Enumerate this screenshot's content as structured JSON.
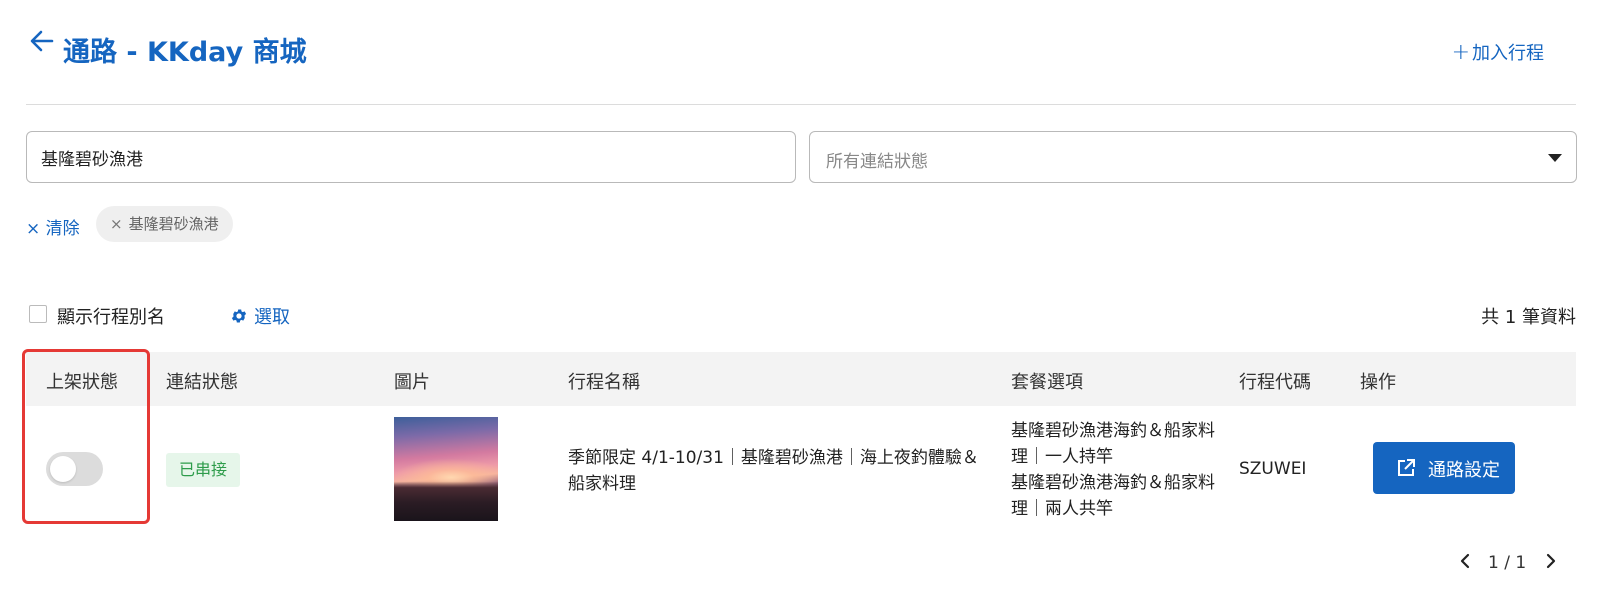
{
  "header": {
    "title": "通路  - KKday 商城",
    "add_label": "加入行程",
    "add_icon": "plus-icon",
    "back_icon": "arrow-left-icon"
  },
  "filters": {
    "search_value": "基隆碧砂漁港",
    "status_placeholder": "所有連結狀態",
    "clear_label": "清除",
    "chips": [
      "基隆碧砂漁港"
    ]
  },
  "toolbar": {
    "show_alias_label": "顯示行程別名",
    "show_alias_checked": false,
    "select_label": "選取",
    "total_text": "共 1 筆資料"
  },
  "table": {
    "columns": [
      "上架狀態",
      "連結狀態",
      "圖片",
      "行程名稱",
      "套餐選項",
      "行程代碼",
      "操作"
    ],
    "rows": [
      {
        "listed": false,
        "link_status": "已串接",
        "trip_name": "季節限定 4/1-10/31｜基隆碧砂漁港｜海上夜釣體驗＆船家料理",
        "packages": [
          "基隆碧砂漁港海釣＆船家料理｜一人持竿",
          "基隆碧砂漁港海釣＆船家料理｜兩人共竿"
        ],
        "trip_code": "SZUWEI",
        "action_label": "通路設定"
      }
    ]
  },
  "pagination": {
    "text": "1 / 1"
  },
  "colors": {
    "primary": "#1565c0",
    "badge_bg": "#e6f6ea",
    "badge_text": "#2e9c4b",
    "highlight": "#e53935"
  }
}
